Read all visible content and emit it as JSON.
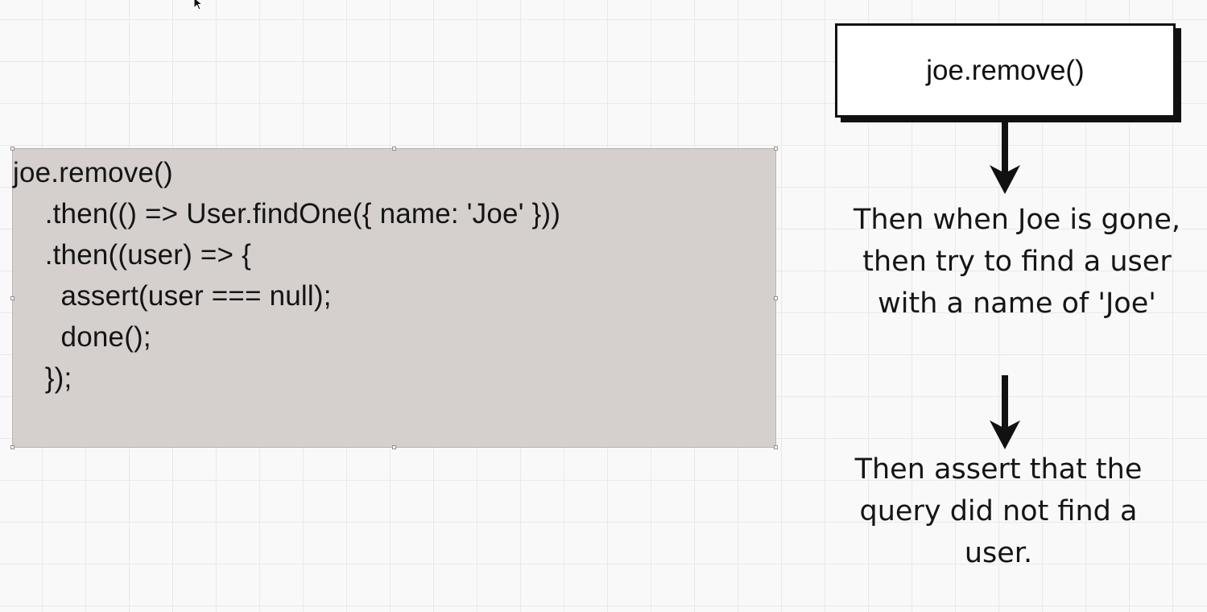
{
  "code_box": {
    "lines": [
      "joe.remove()",
      "    .then(() => User.findOne({ name: 'Joe' }))",
      "    .then((user) => {",
      "      assert(user === null);",
      "      done();",
      "    });"
    ]
  },
  "flow": {
    "box_label": "joe.remove()",
    "note_1": "Then when Joe is gone,\nthen try to find a user\nwith a name of 'Joe'",
    "note_2": "Then assert that the\nquery did not find a\nuser."
  },
  "icons": [
    "cursor-arrow-icon",
    "arrow-down-icon"
  ]
}
